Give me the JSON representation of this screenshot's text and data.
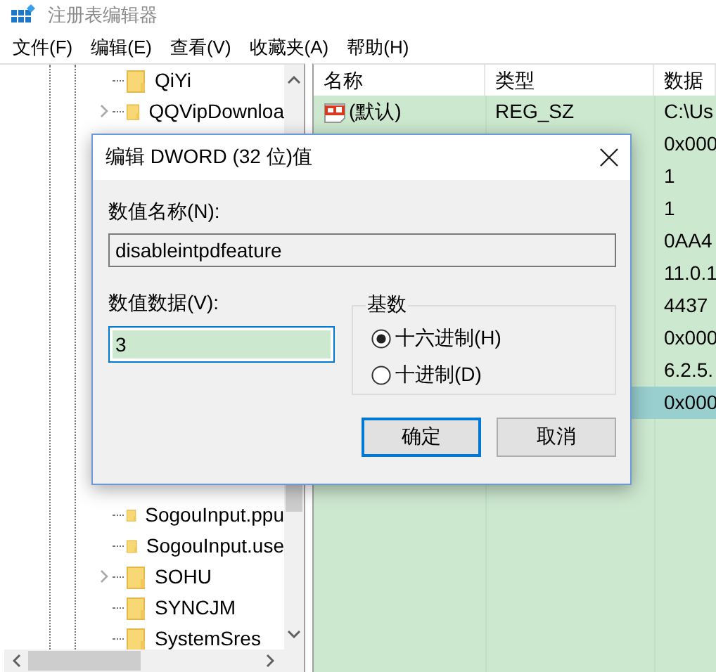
{
  "window": {
    "title": "注册表编辑器"
  },
  "menu": [
    "文件(F)",
    "编辑(E)",
    "查看(V)",
    "收藏夹(A)",
    "帮助(H)"
  ],
  "tree": {
    "items": [
      {
        "label": "QiYi",
        "expandable": false
      },
      {
        "label": "QQVipDownloa",
        "expandable": true
      },
      {
        "label": "SogouInput.ppu",
        "expandable": false
      },
      {
        "label": "SogouInput.use",
        "expandable": false
      },
      {
        "label": "SOHU",
        "expandable": true
      },
      {
        "label": "SYNCJM",
        "expandable": false
      },
      {
        "label": "SystemSres",
        "expandable": false
      }
    ]
  },
  "list": {
    "columns": [
      "名称",
      "类型",
      "数据"
    ],
    "rows": [
      {
        "name": "(默认)",
        "type": "REG_SZ",
        "data": "C:\\Us",
        "selected": false
      },
      {
        "data": "0x000",
        "selected": false
      },
      {
        "data": "1",
        "selected": false
      },
      {
        "data": "1",
        "selected": false
      },
      {
        "data": "0AA4",
        "selected": false
      },
      {
        "data": "11.0.1",
        "selected": false
      },
      {
        "data": "4437",
        "selected": false
      },
      {
        "data": "0x000",
        "selected": false
      },
      {
        "data": "6.2.5.",
        "selected": false
      },
      {
        "data": "0x000",
        "selected": true
      }
    ]
  },
  "dialog": {
    "title": "编辑 DWORD (32 位)值",
    "name_label": "数值名称(N):",
    "name_value": "disableintpdfeature",
    "data_label": "数值数据(V):",
    "data_value": "3",
    "base": {
      "label": "基数",
      "options": [
        {
          "label": "十六进制(H)",
          "selected": true
        },
        {
          "label": "十进制(D)",
          "selected": false
        }
      ]
    },
    "buttons": [
      {
        "label": "确定",
        "default": true
      },
      {
        "label": "取消",
        "default": false
      }
    ]
  }
}
